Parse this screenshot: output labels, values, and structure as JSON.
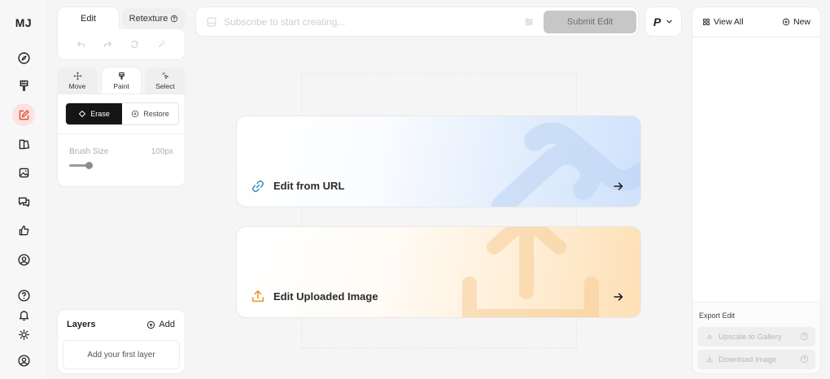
{
  "app": {
    "logo": "MJ"
  },
  "left_nav": [
    {
      "icon": "compass-icon",
      "active": false
    },
    {
      "icon": "paintbrush-icon",
      "active": false
    },
    {
      "icon": "edit-icon",
      "active": true
    },
    {
      "icon": "layers-book-icon",
      "active": false
    },
    {
      "icon": "image-icon",
      "active": false
    },
    {
      "icon": "chat-icon",
      "active": false
    },
    {
      "icon": "thumbs-up-icon",
      "active": false
    },
    {
      "icon": "profile-icon",
      "active": false
    },
    {
      "icon": "help-icon",
      "active": false
    },
    {
      "icon": "bell-icon",
      "active": false
    },
    {
      "icon": "sun-icon",
      "active": false
    },
    {
      "icon": "account-icon",
      "active": false
    }
  ],
  "mode_tabs": {
    "edit": "Edit",
    "retexture": "Retexture"
  },
  "tool_tabs": {
    "move": "Move",
    "paint": "Paint",
    "select": "Select"
  },
  "paint_mode": {
    "erase": "Erase",
    "restore": "Restore",
    "selected": "Erase"
  },
  "brush": {
    "label": "Brush Size",
    "value": "100px",
    "level": 0.1
  },
  "layers": {
    "title": "Layers",
    "add": "Add",
    "empty": "Add your first layer"
  },
  "prompt": {
    "placeholder": "Subscribe to start creating...",
    "submit": "Submit Edit"
  },
  "version": {
    "label": "P"
  },
  "cards": {
    "url": "Edit from URL",
    "upload": "Edit Uploaded Image"
  },
  "right_panel": {
    "view_all": "View All",
    "new": "New",
    "export_title": "Export Edit",
    "upscale": "Upscale to Gallery",
    "download": "Download Image"
  },
  "colors": {
    "accent_active": "#e0533a",
    "url_card": "#cfe2fb",
    "upload_card": "#fde0b5",
    "upload_icon": "#e69b2e",
    "link_icon": "#3c8fc4"
  }
}
